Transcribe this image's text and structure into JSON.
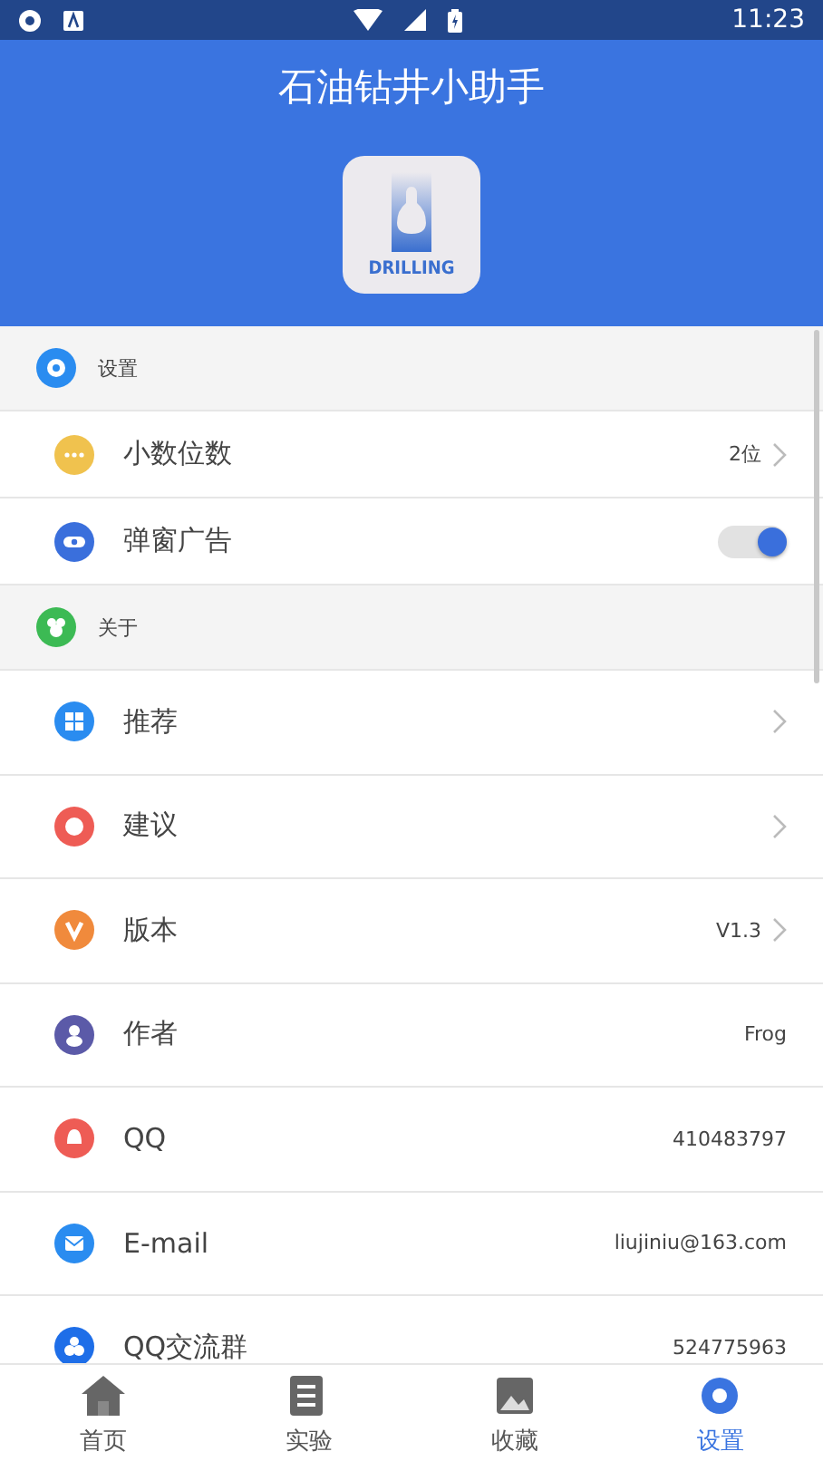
{
  "status_bar": {
    "time": "11:23"
  },
  "header": {
    "title": "石油钻井小助手",
    "logo_text": "DRILLING"
  },
  "sections": [
    {
      "title": "设置",
      "color": "#2a8cf0",
      "items": [
        {
          "kind": "value",
          "label": "小数位数",
          "value": "2位",
          "chevron": true,
          "color": "#f0c24e"
        },
        {
          "kind": "switch",
          "label": "弹窗广告",
          "on": true,
          "color": "#3a6fdc"
        }
      ]
    },
    {
      "title": "关于",
      "color": "#3cba54",
      "items": [
        {
          "kind": "value",
          "label": "推荐",
          "chevron": true,
          "color": "#2a8cf0"
        },
        {
          "kind": "value",
          "label": "建议",
          "chevron": true,
          "color": "#ee5c55"
        },
        {
          "kind": "value",
          "label": "版本",
          "value": "V1.3",
          "chevron": true,
          "color": "#f08a3c"
        },
        {
          "kind": "value",
          "label": "作者",
          "value": "Frog",
          "chevron": false,
          "color": "#5b5aa8"
        },
        {
          "kind": "value",
          "label": "QQ",
          "value": "410483797",
          "chevron": false,
          "color": "#ee5c55"
        },
        {
          "kind": "value",
          "label": "E-mail",
          "value": "liujiniu@163.com",
          "chevron": false,
          "color": "#2a8cf0"
        },
        {
          "kind": "value",
          "label": "QQ交流群",
          "value": "524775963",
          "chevron": false,
          "color": "#1e6ee8"
        }
      ]
    }
  ],
  "tabs": [
    {
      "label": "首页",
      "selected": false
    },
    {
      "label": "实验",
      "selected": false
    },
    {
      "label": "收藏",
      "selected": false
    },
    {
      "label": "设置",
      "selected": true
    }
  ]
}
